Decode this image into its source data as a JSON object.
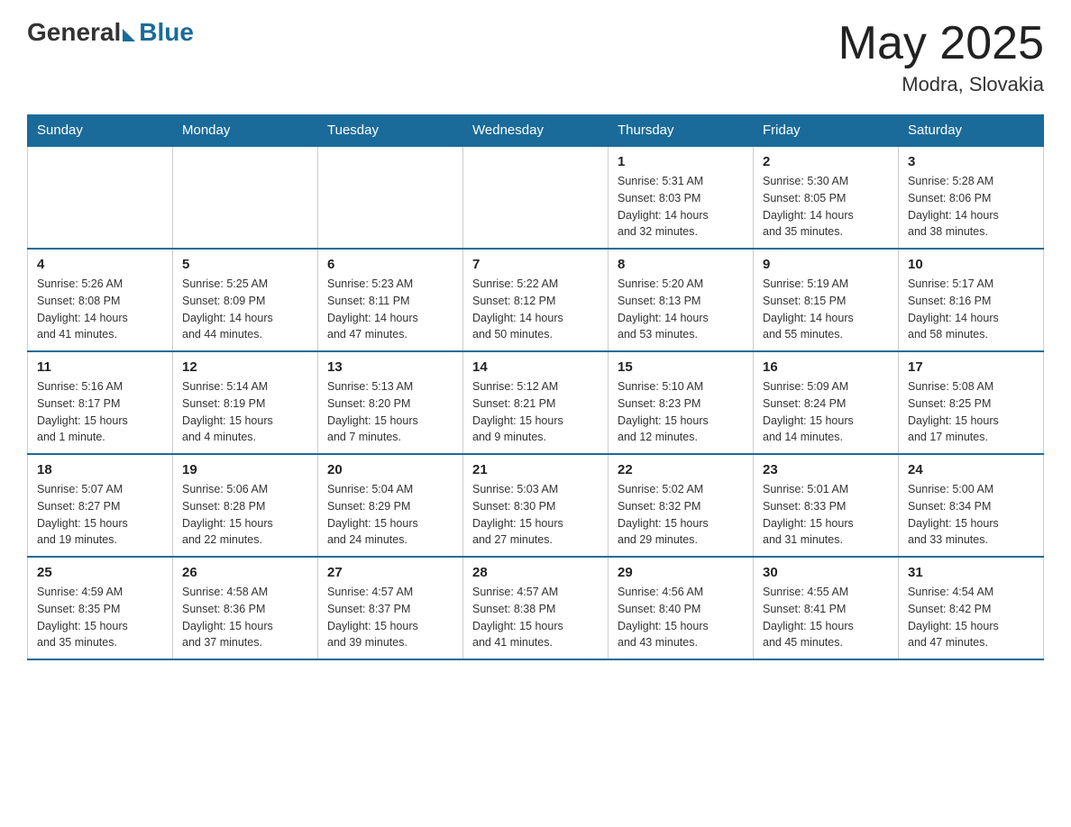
{
  "header": {
    "logo_general": "General",
    "logo_blue": "Blue",
    "month_title": "May 2025",
    "location": "Modra, Slovakia"
  },
  "weekdays": [
    "Sunday",
    "Monday",
    "Tuesday",
    "Wednesday",
    "Thursday",
    "Friday",
    "Saturday"
  ],
  "weeks": [
    [
      {
        "day": "",
        "info": ""
      },
      {
        "day": "",
        "info": ""
      },
      {
        "day": "",
        "info": ""
      },
      {
        "day": "",
        "info": ""
      },
      {
        "day": "1",
        "info": "Sunrise: 5:31 AM\nSunset: 8:03 PM\nDaylight: 14 hours\nand 32 minutes."
      },
      {
        "day": "2",
        "info": "Sunrise: 5:30 AM\nSunset: 8:05 PM\nDaylight: 14 hours\nand 35 minutes."
      },
      {
        "day": "3",
        "info": "Sunrise: 5:28 AM\nSunset: 8:06 PM\nDaylight: 14 hours\nand 38 minutes."
      }
    ],
    [
      {
        "day": "4",
        "info": "Sunrise: 5:26 AM\nSunset: 8:08 PM\nDaylight: 14 hours\nand 41 minutes."
      },
      {
        "day": "5",
        "info": "Sunrise: 5:25 AM\nSunset: 8:09 PM\nDaylight: 14 hours\nand 44 minutes."
      },
      {
        "day": "6",
        "info": "Sunrise: 5:23 AM\nSunset: 8:11 PM\nDaylight: 14 hours\nand 47 minutes."
      },
      {
        "day": "7",
        "info": "Sunrise: 5:22 AM\nSunset: 8:12 PM\nDaylight: 14 hours\nand 50 minutes."
      },
      {
        "day": "8",
        "info": "Sunrise: 5:20 AM\nSunset: 8:13 PM\nDaylight: 14 hours\nand 53 minutes."
      },
      {
        "day": "9",
        "info": "Sunrise: 5:19 AM\nSunset: 8:15 PM\nDaylight: 14 hours\nand 55 minutes."
      },
      {
        "day": "10",
        "info": "Sunrise: 5:17 AM\nSunset: 8:16 PM\nDaylight: 14 hours\nand 58 minutes."
      }
    ],
    [
      {
        "day": "11",
        "info": "Sunrise: 5:16 AM\nSunset: 8:17 PM\nDaylight: 15 hours\nand 1 minute."
      },
      {
        "day": "12",
        "info": "Sunrise: 5:14 AM\nSunset: 8:19 PM\nDaylight: 15 hours\nand 4 minutes."
      },
      {
        "day": "13",
        "info": "Sunrise: 5:13 AM\nSunset: 8:20 PM\nDaylight: 15 hours\nand 7 minutes."
      },
      {
        "day": "14",
        "info": "Sunrise: 5:12 AM\nSunset: 8:21 PM\nDaylight: 15 hours\nand 9 minutes."
      },
      {
        "day": "15",
        "info": "Sunrise: 5:10 AM\nSunset: 8:23 PM\nDaylight: 15 hours\nand 12 minutes."
      },
      {
        "day": "16",
        "info": "Sunrise: 5:09 AM\nSunset: 8:24 PM\nDaylight: 15 hours\nand 14 minutes."
      },
      {
        "day": "17",
        "info": "Sunrise: 5:08 AM\nSunset: 8:25 PM\nDaylight: 15 hours\nand 17 minutes."
      }
    ],
    [
      {
        "day": "18",
        "info": "Sunrise: 5:07 AM\nSunset: 8:27 PM\nDaylight: 15 hours\nand 19 minutes."
      },
      {
        "day": "19",
        "info": "Sunrise: 5:06 AM\nSunset: 8:28 PM\nDaylight: 15 hours\nand 22 minutes."
      },
      {
        "day": "20",
        "info": "Sunrise: 5:04 AM\nSunset: 8:29 PM\nDaylight: 15 hours\nand 24 minutes."
      },
      {
        "day": "21",
        "info": "Sunrise: 5:03 AM\nSunset: 8:30 PM\nDaylight: 15 hours\nand 27 minutes."
      },
      {
        "day": "22",
        "info": "Sunrise: 5:02 AM\nSunset: 8:32 PM\nDaylight: 15 hours\nand 29 minutes."
      },
      {
        "day": "23",
        "info": "Sunrise: 5:01 AM\nSunset: 8:33 PM\nDaylight: 15 hours\nand 31 minutes."
      },
      {
        "day": "24",
        "info": "Sunrise: 5:00 AM\nSunset: 8:34 PM\nDaylight: 15 hours\nand 33 minutes."
      }
    ],
    [
      {
        "day": "25",
        "info": "Sunrise: 4:59 AM\nSunset: 8:35 PM\nDaylight: 15 hours\nand 35 minutes."
      },
      {
        "day": "26",
        "info": "Sunrise: 4:58 AM\nSunset: 8:36 PM\nDaylight: 15 hours\nand 37 minutes."
      },
      {
        "day": "27",
        "info": "Sunrise: 4:57 AM\nSunset: 8:37 PM\nDaylight: 15 hours\nand 39 minutes."
      },
      {
        "day": "28",
        "info": "Sunrise: 4:57 AM\nSunset: 8:38 PM\nDaylight: 15 hours\nand 41 minutes."
      },
      {
        "day": "29",
        "info": "Sunrise: 4:56 AM\nSunset: 8:40 PM\nDaylight: 15 hours\nand 43 minutes."
      },
      {
        "day": "30",
        "info": "Sunrise: 4:55 AM\nSunset: 8:41 PM\nDaylight: 15 hours\nand 45 minutes."
      },
      {
        "day": "31",
        "info": "Sunrise: 4:54 AM\nSunset: 8:42 PM\nDaylight: 15 hours\nand 47 minutes."
      }
    ]
  ]
}
